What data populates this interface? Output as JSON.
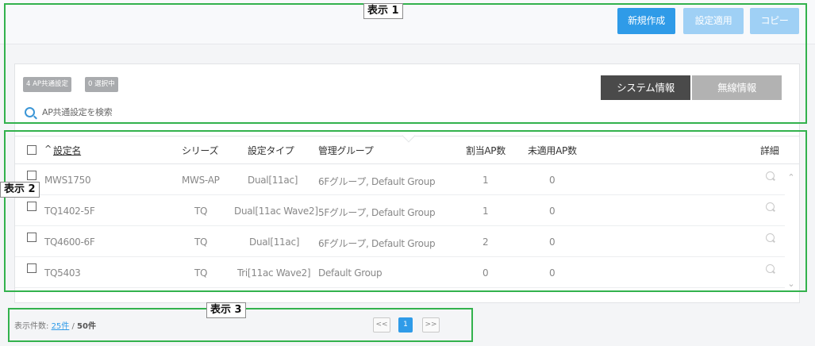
{
  "toolbar": {
    "new_label": "新規作成",
    "apply_label": "設定適用",
    "copy_label": "コピー"
  },
  "filter": {
    "count_badge": "4 AP共通設定",
    "selected_badge": "0 選択中",
    "search_placeholder": "AP共通設定を検索"
  },
  "tabs": [
    {
      "label": "システム情報",
      "active": true
    },
    {
      "label": "無線情報",
      "active": false
    }
  ],
  "table": {
    "sort_indicator": "^",
    "columns": [
      "設定名",
      "シリーズ",
      "設定タイプ",
      "管理グループ",
      "割当AP数",
      "未適用AP数",
      "詳細"
    ],
    "rows": [
      {
        "name": "MWS1750",
        "series": "MWS-AP",
        "type": "Dual[11ac]",
        "group": "6Fグループ, Default Group",
        "assigned": "1",
        "unapplied": "0"
      },
      {
        "name": "TQ1402-5F",
        "series": "TQ",
        "type": "Dual[11ac Wave2]",
        "group": "5Fグループ, Default Group",
        "assigned": "1",
        "unapplied": "0"
      },
      {
        "name": "TQ4600-6F",
        "series": "TQ",
        "type": "Dual[11ac]",
        "group": "6Fグループ, Default Group",
        "assigned": "2",
        "unapplied": "0"
      },
      {
        "name": "TQ5403",
        "series": "TQ",
        "type": "Tri[11ac Wave2]",
        "group": "Default Group",
        "assigned": "0",
        "unapplied": "0"
      }
    ]
  },
  "footer": {
    "display_label": "表示件数:",
    "per_page": "25件",
    "separator": "/",
    "total": "50件",
    "prev": "<<",
    "current_page": "1",
    "next": ">>"
  },
  "annotations": {
    "label1": "表示 1",
    "label2": "表示 2",
    "label3": "表示 3"
  },
  "colors": {
    "primary": "#2f9be8",
    "primary_disabled": "#9fd0f5",
    "annotation_green": "#33b24d",
    "tab_active": "#4a4a4a",
    "tab_inactive": "#b2b2b2"
  }
}
